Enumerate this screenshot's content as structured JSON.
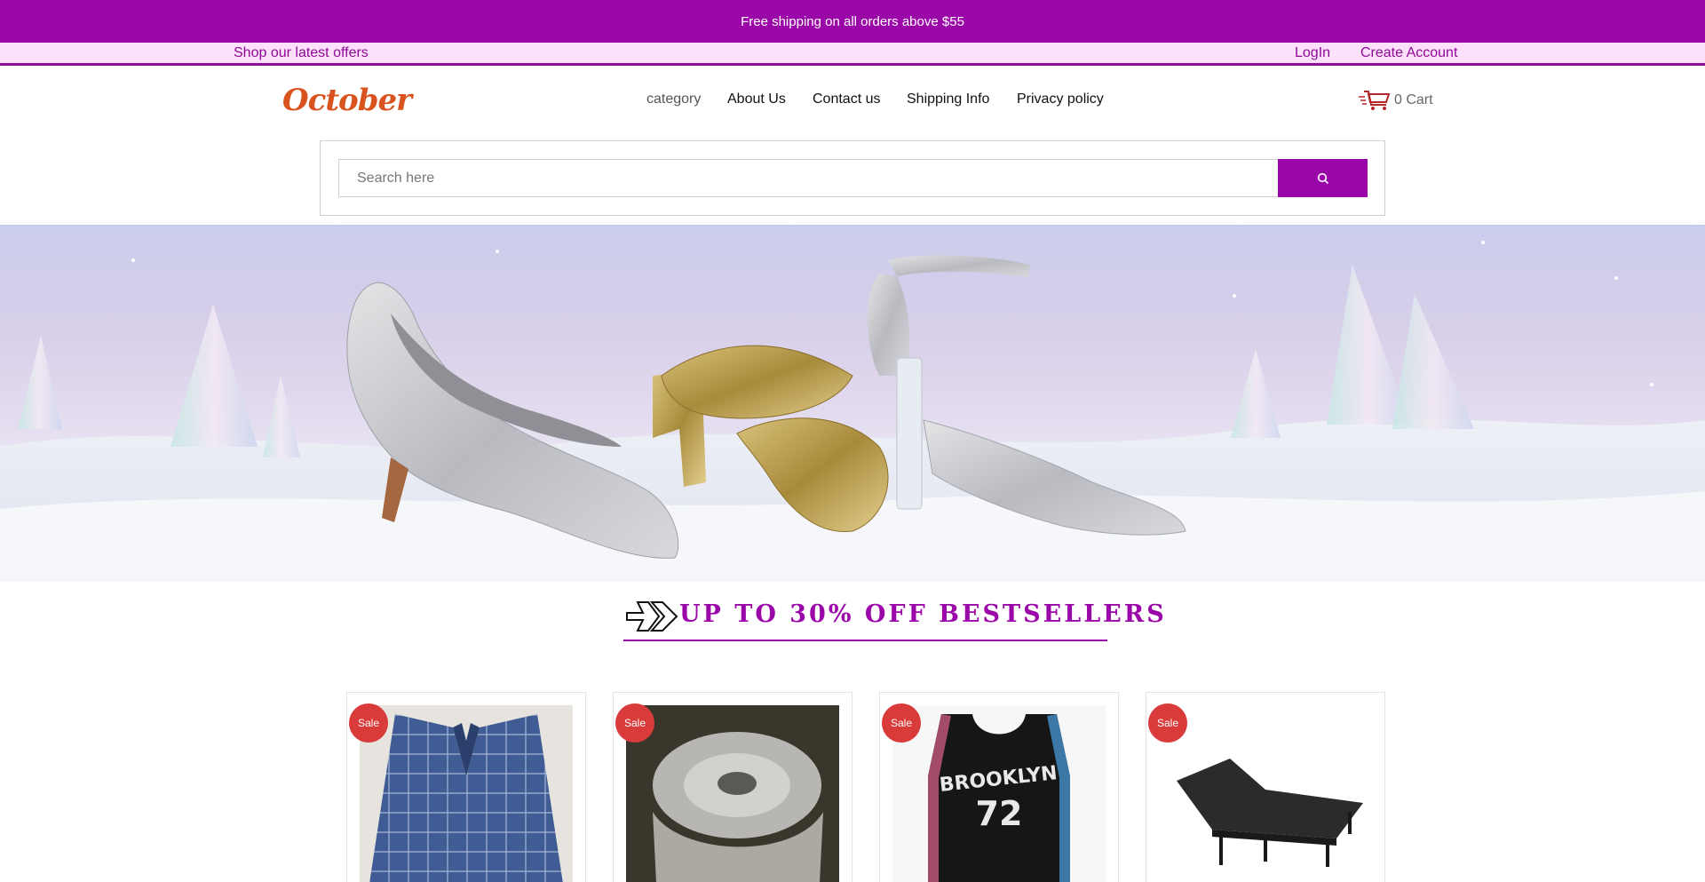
{
  "announcement": "Free shipping on all orders above $55",
  "subbar": {
    "offers": "Shop our latest offers",
    "login": "LogIn",
    "create_account": "Create Account"
  },
  "brand": {
    "logo_text": "October",
    "accent": "#9a06a8",
    "logo_color": "#d9531e"
  },
  "nav": {
    "category": "category",
    "about": "About Us",
    "contact": "Contact us",
    "shipping": "Shipping Info",
    "privacy": "Privacy policy"
  },
  "cart": {
    "label": "0 Cart",
    "icon": "cart-icon"
  },
  "search": {
    "placeholder": "Search here",
    "icon": "search-icon"
  },
  "promo": {
    "title": "UP TO 30% OFF BESTSELLERS",
    "icon": "double-chevron-right-icon"
  },
  "products": [
    {
      "badge": "Sale",
      "image": "blue plaid blazer"
    },
    {
      "badge": "Sale",
      "image": "brake rotor"
    },
    {
      "badge": "Sale",
      "image": "basketball jersey",
      "jersey_text": "BROOKLYN",
      "jersey_number": "72"
    },
    {
      "badge": "Sale",
      "image": "adjustable bed base"
    }
  ]
}
